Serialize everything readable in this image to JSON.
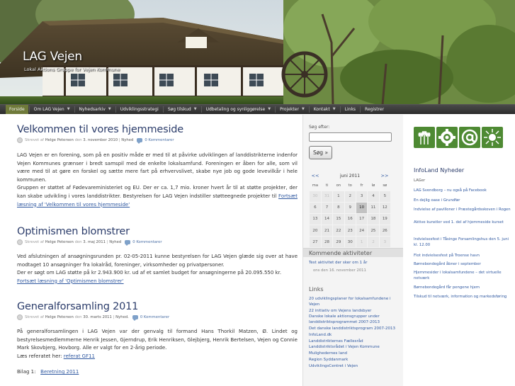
{
  "header": {
    "title": "LAG Vejen",
    "description": "Lokal Aktions Gruppe for Vejen Kommune"
  },
  "nav": {
    "items": [
      {
        "label": "Forside",
        "has_dropdown": false,
        "active": true
      },
      {
        "label": "Om LAG Vejen",
        "has_dropdown": true,
        "active": false
      },
      {
        "label": "Nyhedsarkiv",
        "has_dropdown": true,
        "active": false
      },
      {
        "label": "Udviklingsstrategi",
        "has_dropdown": false,
        "active": false
      },
      {
        "label": "Søg tilskud",
        "has_dropdown": true,
        "active": false
      },
      {
        "label": "Udbetaling og synliggørelse",
        "has_dropdown": true,
        "active": false
      },
      {
        "label": "Projekter",
        "has_dropdown": true,
        "active": false
      },
      {
        "label": "Kontakt",
        "has_dropdown": true,
        "active": false
      },
      {
        "label": "Links",
        "has_dropdown": false,
        "active": false
      },
      {
        "label": "Registrer",
        "has_dropdown": false,
        "active": false
      }
    ],
    "caret": "▼"
  },
  "posts": [
    {
      "title": "Velkommen til vores hjemmeside",
      "meta": {
        "by": "Skrevet af",
        "author": "Helge Petersen",
        "on": "den",
        "date": "3. november 2010",
        "sep": "|",
        "category": "Nyhed",
        "comments": "0 Kommentarer"
      },
      "body": "LAG Vejen er en forening, som på en positiv måde er med til at påvirke udviklingen af landdistrikterne indenfor Vejen Kommunes grænser i bredt samspil med de enkelte lokalsamfund. Foreningen er åben for alle, som vil være med til at gøre en forskel og sætte mere fart på erhvervslivet, skabe nye job og gode levevilkår i hele kommunen.",
      "body2": "Gruppen er støttet af Fødevareministeriet og EU. Der er ca. 1,7 mio. kroner hvert år til at støtte projekter, der kan skabe udvikling i vores landdistrikter. Bestyrelsen for LAG Vejen indstiller støtteegnede projekter til",
      "more": "Fortsæt læsning af 'Velkommen til vores hjemmeside'"
    },
    {
      "title": "Optimismen blomstrer",
      "meta": {
        "by": "Skrevet af",
        "author": "Helge Petersen",
        "on": "den",
        "date": "3. maj 2011",
        "sep": "|",
        "category": "Nyhed",
        "comments": "0 Kommentarer"
      },
      "body": "Ved afslutningen af ansøgningsrunden pr. 02-05-2011 kunne bestyrelsen for LAG Vejen glæde sig over at have modtaget 10 ansøgninger fra lokalråd, foreninger, virksomheder og privatpersoner.",
      "body2": "Der er søgt om LAG støtte på kr 2.943.900 kr. ud af et samlet budget for ansøgningerne på 20.095.550 kr.",
      "more": "Fortsæt læsning af 'Optimismen blomstrer'"
    },
    {
      "title": "Generalforsamling 2011",
      "meta": {
        "by": "Skrevet af",
        "author": "Helge Petersen",
        "on": "den",
        "date": "30. marts 2011",
        "sep": "|",
        "category": "Nyhed.",
        "comments": "0 Kommentarer"
      },
      "body": "På generalforsamlingen i LAG Vejen var der genvalg til formand Hans Thorkil Matzen, Ø. Lindet og bestyrelsesmedlemmerne Henrik Jessen, Gjerndrup, Erik Henriksen, Glejbjerg, Henrik Bertelsen, Vejen og Connie Mark Skovbjerg, Hovborg. Alle er valgt for en 2-årig periode.",
      "body2_prefix": "Læs referatet her: ",
      "body2_link": "referat GF11",
      "attach_prefix": "Bilag 1:",
      "attach_link": "Beretning 2011"
    }
  ],
  "sidebar": {
    "search_label": "Søg efter:",
    "search_value": "",
    "search_button": "Søg »",
    "calendar": {
      "prev": "<<",
      "next": ">>",
      "month": "juni 2011",
      "weekdays": [
        "ma",
        "ti",
        "on",
        "to",
        "fr",
        "lø",
        "sø"
      ],
      "weeks": [
        [
          {
            "d": "30",
            "o": true
          },
          {
            "d": "31",
            "o": true
          },
          {
            "d": "1"
          },
          {
            "d": "2"
          },
          {
            "d": "3"
          },
          {
            "d": "4"
          },
          {
            "d": "5"
          }
        ],
        [
          {
            "d": "6"
          },
          {
            "d": "7"
          },
          {
            "d": "8"
          },
          {
            "d": "9"
          },
          {
            "d": "10",
            "t": true
          },
          {
            "d": "11"
          },
          {
            "d": "12"
          }
        ],
        [
          {
            "d": "13"
          },
          {
            "d": "14"
          },
          {
            "d": "15"
          },
          {
            "d": "16"
          },
          {
            "d": "17"
          },
          {
            "d": "18"
          },
          {
            "d": "19"
          }
        ],
        [
          {
            "d": "20"
          },
          {
            "d": "21"
          },
          {
            "d": "22"
          },
          {
            "d": "23"
          },
          {
            "d": "24"
          },
          {
            "d": "25"
          },
          {
            "d": "26"
          }
        ],
        [
          {
            "d": "27"
          },
          {
            "d": "28"
          },
          {
            "d": "29"
          },
          {
            "d": "30"
          },
          {
            "d": "1",
            "o": true
          },
          {
            "d": "2",
            "o": true
          },
          {
            "d": "3",
            "o": true
          }
        ]
      ]
    },
    "activities_heading": "Kommende aktiviteter",
    "activity_link": "Test aktivitet der sker om 1 år",
    "activity_date": "ons den 16. november 2011",
    "links_heading": "Links",
    "links": [
      "20 udviklingsplaner for lokalsamfundene i Vejen",
      "22 initiativ om Vejens landsbyer",
      "Danske lokale aktionsgrupper under landdistriktsprogrammet 2007-2013",
      "Det danske landdistriktsprogram 2007-2013",
      "InfoLand.dk",
      "Landdistrikternes Fællesråd",
      "Landdistriktsrådet i Vejen Kommune",
      "Mulighedernes land",
      "Region Syddanmark",
      "UdviklingsCentret i Vejen"
    ]
  },
  "right": {
    "logos": [
      "wheat-logo-icon",
      "gear-logo-icon",
      "at-sign-logo-icon",
      "sun-logo-icon"
    ],
    "heading": "InfoLand Nyheder",
    "source": "LAGer",
    "items": [
      "LAG Svendborg – nu også på Facebook",
      "En dejlig oase i Grundfør",
      "Indvielse af pavilloner i Præstegårdsskoven i Rogen",
      "Aktive kunstler ved 1. del af hjemmeside kurset",
      "Indvielsesfest i Tåsinge Forsamlingshus den 5. juni kl. 12.00",
      "Flot indvielsesfest på Troense havn",
      "Børnebondegård åbner i september",
      "Hjemmesider i lokalsamfundene – det virtuelle netværk",
      "Børnebondegård får pengene hjem",
      "Tilskud til netværk, information og markedsføring"
    ]
  },
  "colors": {
    "title_blue": "#2c3d6b",
    "link_blue": "#2f58a0",
    "nav_bg": "#3a3a3a",
    "nav_active": "#6f7a3a",
    "logo_green": "#4e8a33"
  }
}
